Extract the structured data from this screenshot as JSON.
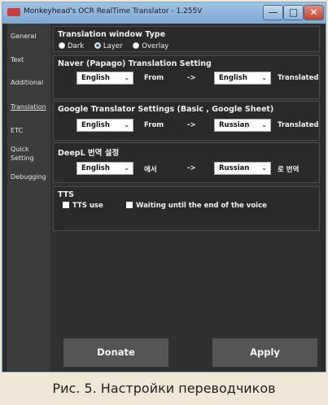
{
  "window": {
    "title": "Monkeyhead's OCR RealTime Translator - 1.255V",
    "minimize_glyph": "—",
    "maximize_glyph": "□",
    "close_glyph": "✕"
  },
  "sidebar": {
    "items": [
      {
        "label": "General"
      },
      {
        "label": "Text"
      },
      {
        "label": "Additional"
      },
      {
        "label": "Translation"
      },
      {
        "label": "ETC"
      },
      {
        "label": "Quick Setting"
      },
      {
        "label": "Debugging"
      }
    ],
    "active": "Translation"
  },
  "window_type": {
    "title": "Translation window Type",
    "options": [
      "Dark",
      "Layer",
      "Overlay"
    ],
    "selected": "Layer"
  },
  "naver": {
    "title": "Naver (Papago) Translation Setting",
    "source": "English",
    "from_label": "From",
    "arrow": "->",
    "target": "English",
    "result_label": "Translated"
  },
  "google": {
    "title": "Google Translator Settings (Basic , Google Sheet)",
    "source": "English",
    "from_label": "From",
    "arrow": "->",
    "target": "Russian",
    "result_label": "Translated"
  },
  "deepl": {
    "title": "DeepL 번역 설정",
    "source": "English",
    "from_label": "에서",
    "arrow": "->",
    "target": "Russian",
    "result_label": "로 번역"
  },
  "tts": {
    "title": "TTS",
    "use_label": "TTS use",
    "wait_label": "Waiting until the end of the voice"
  },
  "buttons": {
    "donate": "Donate",
    "apply": "Apply"
  },
  "caption": "Рис. 5. Настройки переводчиков",
  "colors": {
    "background": "#2d2d2d",
    "titlebar": "#8fb6dc",
    "close_button": "#c6452f",
    "caption_bg": "#f2e6d6"
  }
}
